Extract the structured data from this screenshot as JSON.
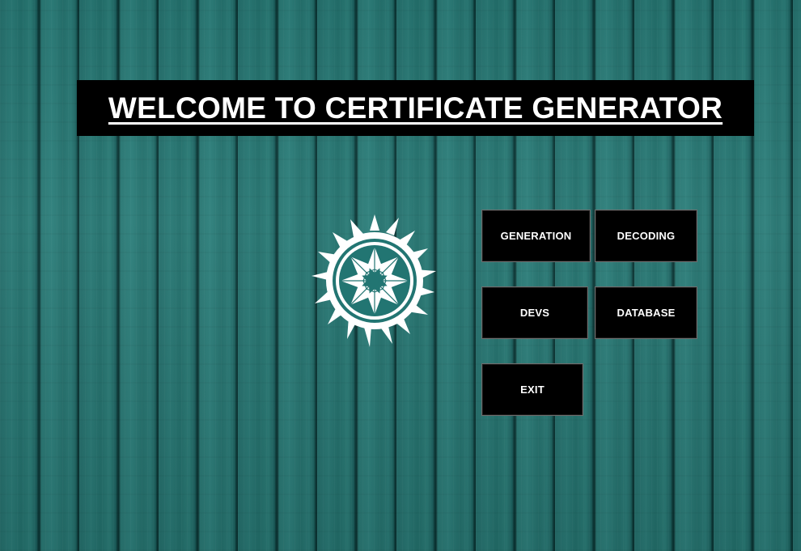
{
  "window": {
    "title": "WELCOME TO CERTIFICATE GENERATOR"
  },
  "logo": {
    "icon": "sun-star-emblem-icon",
    "color": "#ffffff"
  },
  "menu": {
    "generation_label": "GENERATION",
    "decoding_label": "DECODING",
    "devs_label": "DEVS",
    "database_label": "DATABASE",
    "exit_label": "EXIT"
  },
  "colors": {
    "background": "#1f6f6c",
    "button_bg": "#000000",
    "button_text": "#ffffff",
    "title_bg": "#000000",
    "title_text": "#ffffff"
  }
}
